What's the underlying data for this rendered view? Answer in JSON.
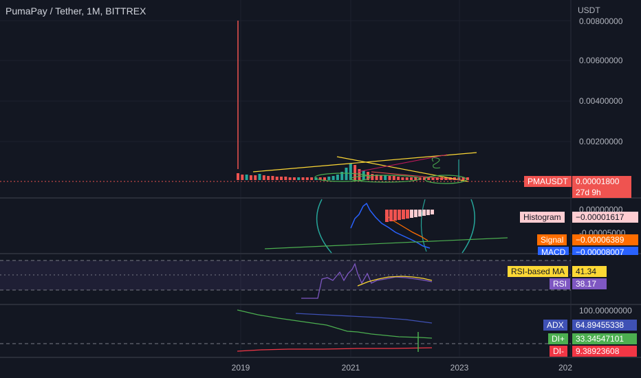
{
  "header": {
    "title": "PumaPay / Tether, 1M, BITTREX"
  },
  "axes": {
    "currency": "USDT",
    "price_ticks": [
      "0.00800000",
      "0.00600000",
      "0.00400000",
      "0.00200000"
    ],
    "macd_ticks": [
      "0.00000000",
      "-0.00005000"
    ],
    "adx_tick": "100.00000000",
    "x_ticks": [
      "2019",
      "2021",
      "2023",
      "202"
    ]
  },
  "tags": {
    "symbol": "PMAUSDT",
    "price": "0.00001800",
    "countdown": "27d 9h",
    "histogram_label": "Histogram",
    "histogram_value": "−0.00001617",
    "signal_label": "Signal",
    "signal_value": "−0.00006389",
    "macd_label": "MACD",
    "macd_value": "−0.00008007",
    "rsi_ma_label": "RSI-based MA",
    "rsi_ma_value": "41.34",
    "rsi_label": "RSI",
    "rsi_value": "38.17",
    "adx_label": "ADX",
    "adx_value": "64.89455338",
    "dip_label": "DI+",
    "dip_value": "33.34547101",
    "dim_label": "DI-",
    "dim_value": "9.38923608"
  },
  "colors": {
    "background": "#131722",
    "up": "#26a69a",
    "down": "#ef5350",
    "rsi": "#7e57c2",
    "rsi_ma": "#fdd835",
    "macd": "#2962ff",
    "signal": "#ff6d00",
    "adx": "#3f51b5",
    "dip": "#4caf50",
    "dim": "#f23645"
  }
}
